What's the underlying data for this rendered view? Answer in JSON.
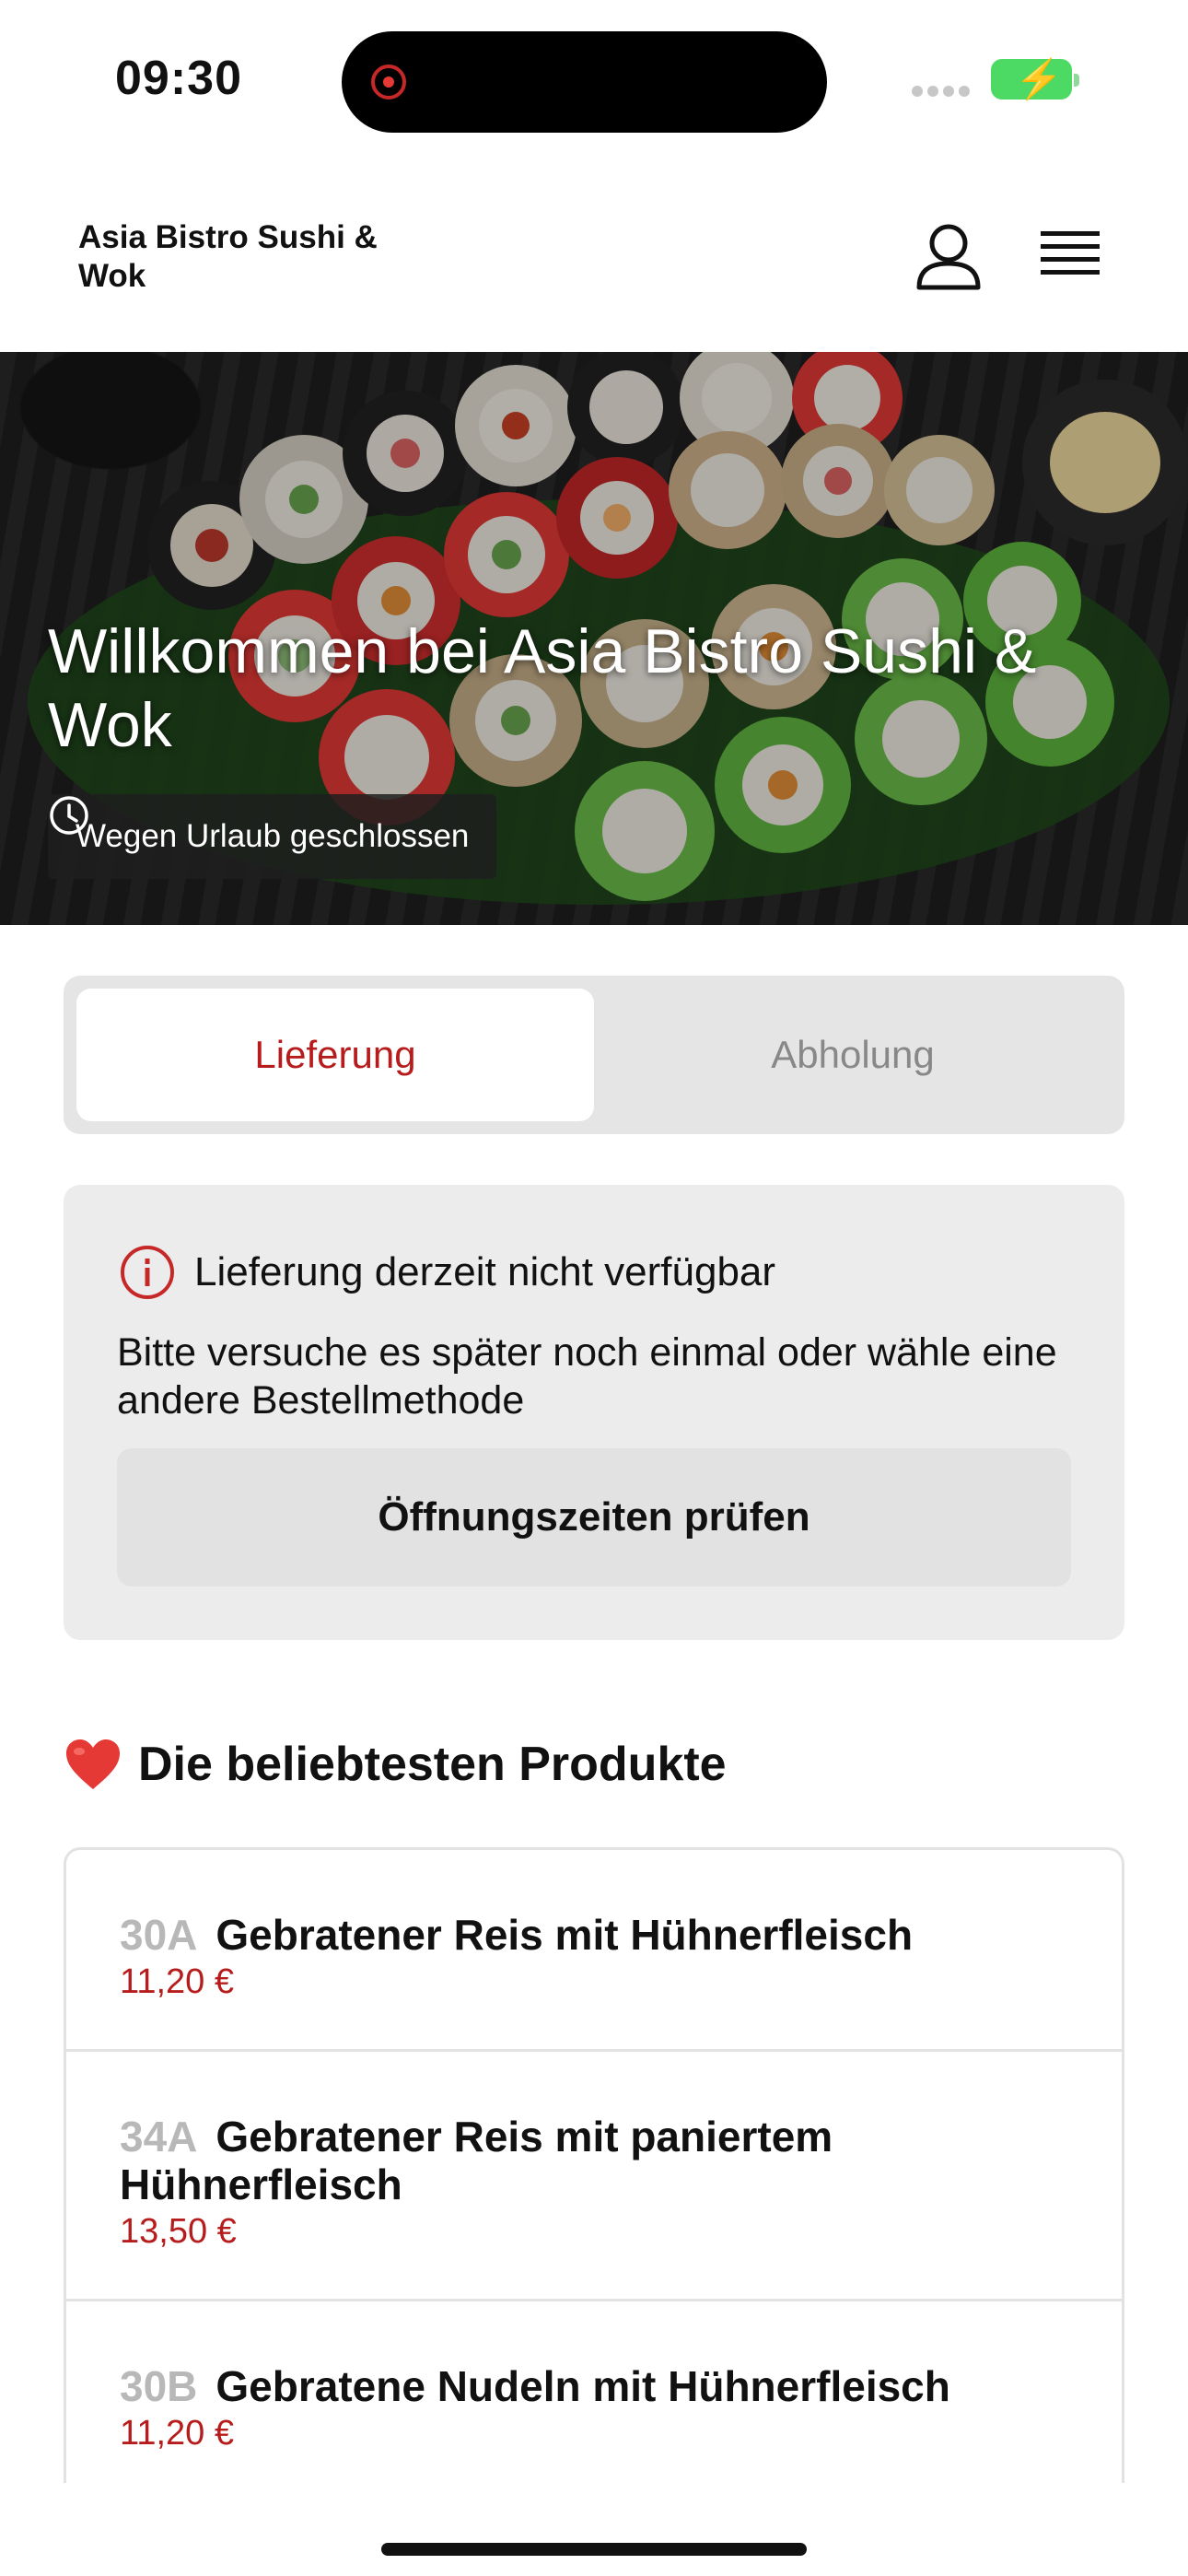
{
  "status_bar": {
    "time": "09:30"
  },
  "header": {
    "brand": "Asia Bistro Sushi & Wok",
    "user_icon": "user-icon",
    "menu_icon": "hamburger-menu-icon"
  },
  "hero": {
    "title": "Willkommen bei Asia Bistro Sushi & Wok",
    "hours_status": "Wegen Urlaub geschlossen"
  },
  "order_type": {
    "delivery": "Lieferung",
    "pickup": "Abholung",
    "selected": "delivery"
  },
  "notice": {
    "title": "Lieferung derzeit nicht verfügbar",
    "text": "Bitte versuche es später noch einmal oder wähle eine andere Bestellmethode",
    "button": "Öffnungszeiten prüfen"
  },
  "popular": {
    "title": "Die beliebtesten Produkte",
    "products": [
      {
        "number": "30A",
        "name": "Gebratener Reis mit Hühnerfleisch",
        "price": "11,20 €"
      },
      {
        "number": "34A",
        "name": "Gebratener Reis mit paniertem Hühnerfleisch",
        "price": "13,50 €"
      },
      {
        "number": "30B",
        "name": "Gebratene Nudeln mit Hühnerfleisch",
        "price": "11,20 €"
      }
    ]
  },
  "colors": {
    "accent": "#b71c1c",
    "toggle_bg": "#e5e5e5",
    "notice_bg": "#ececec"
  }
}
